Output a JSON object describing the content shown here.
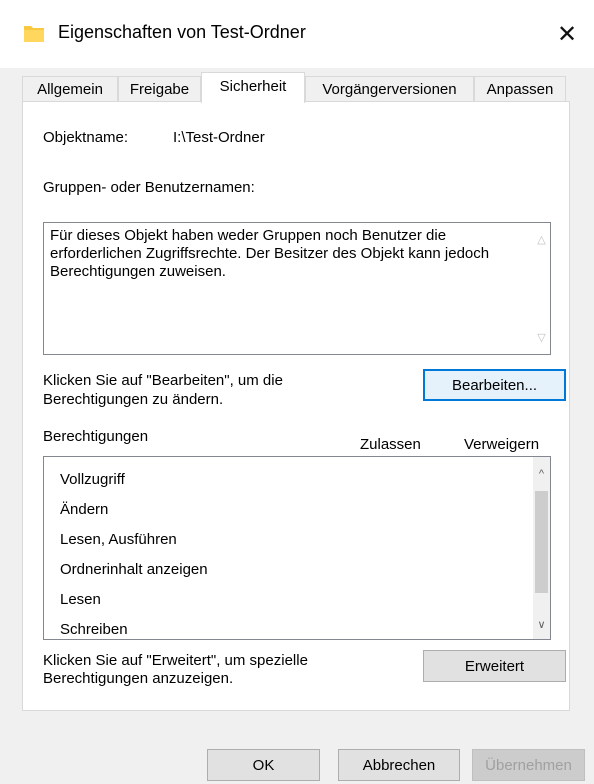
{
  "window": {
    "title": "Eigenschaften von Test-Ordner",
    "close_glyph": "✕"
  },
  "tabs": [
    {
      "label": "Allgemein"
    },
    {
      "label": "Freigabe"
    },
    {
      "label": "Sicherheit"
    },
    {
      "label": "Vorgängerversionen"
    },
    {
      "label": "Anpassen"
    }
  ],
  "security": {
    "object_name_label": "Objektname:",
    "object_name_value": "I:\\Test-Ordner",
    "groups_label": "Gruppen- oder Benutzernamen:",
    "groups_message": "Für dieses Objekt haben weder Gruppen noch Benutzer die erforderlichen Zugriffsrechte. Der Besitzer des Objekt kann jedoch Berechtigungen zuweisen.",
    "edit_hint_line1": "Klicken Sie auf \"Bearbeiten\", um die",
    "edit_hint_line2": "Berechtigungen zu ändern.",
    "edit_button": "Bearbeiten...",
    "permissions_label": "Berechtigungen",
    "col_allow": "Zulassen",
    "col_deny": "Verweigern",
    "permissions": [
      {
        "label": "Vollzugriff"
      },
      {
        "label": "Ändern"
      },
      {
        "label": "Lesen, Ausführen"
      },
      {
        "label": "Ordnerinhalt anzeigen"
      },
      {
        "label": "Lesen"
      },
      {
        "label": "Schreiben"
      }
    ],
    "advanced_hint_line1": "Klicken Sie auf \"Erweitert\", um spezielle",
    "advanced_hint_line2": "Berechtigungen anzuzeigen.",
    "advanced_button": "Erweitert"
  },
  "footer": {
    "ok": "OK",
    "cancel": "Abbrechen",
    "apply": "Übernehmen"
  },
  "colors": {
    "accent": "#0078d7",
    "folder": "#f8c93e"
  }
}
